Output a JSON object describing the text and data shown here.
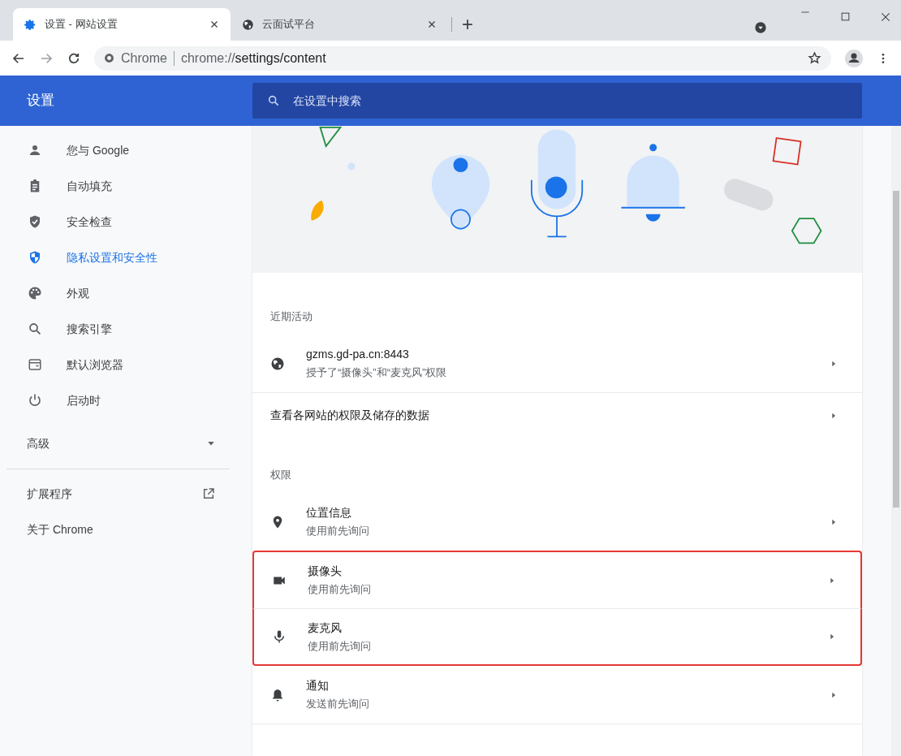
{
  "tabs": [
    {
      "title": "设置 - 网站设置",
      "selected": true,
      "kind": "settings"
    },
    {
      "title": "云面试平台",
      "selected": false,
      "kind": "web"
    }
  ],
  "new_tab": "+",
  "address_bar": {
    "chip": "Chrome",
    "url_host": "chrome://",
    "url_path": "settings/content"
  },
  "header": {
    "title": "设置",
    "search_placeholder": "在设置中搜索"
  },
  "sidebar": {
    "items": [
      {
        "label": "您与 Google",
        "selected": false
      },
      {
        "label": "自动填充",
        "selected": false
      },
      {
        "label": "安全检查",
        "selected": false
      },
      {
        "label": "隐私设置和安全性",
        "selected": true
      },
      {
        "label": "外观",
        "selected": false
      },
      {
        "label": "搜索引擎",
        "selected": false
      },
      {
        "label": "默认浏览器",
        "selected": false
      },
      {
        "label": "启动时",
        "selected": false
      }
    ],
    "advanced": {
      "label": "高级",
      "expanded": false
    },
    "footer_items": [
      {
        "label": "扩展程序",
        "kind": "external"
      },
      {
        "label": "关于 Chrome",
        "kind": "plain"
      }
    ]
  },
  "sections": [
    {
      "heading": "近期活动",
      "rows": [
        {
          "kind": "site",
          "title": "gzms.gd-pa.cn:8443",
          "subtitle": "授予了“摄像头”和“麦克风”权限",
          "highlighted": false
        },
        {
          "kind": "link",
          "title": "查看各网站的权限及储存的数据",
          "highlighted": false
        }
      ]
    },
    {
      "heading": "权限",
      "rows": [
        {
          "kind": "permission",
          "title": "位置信息",
          "subtitle": "使用前先询问",
          "highlighted": false
        },
        {
          "kind": "permission",
          "title": "摄像头",
          "subtitle": "使用前先询问",
          "highlighted": true
        },
        {
          "kind": "permission",
          "title": "麦克风",
          "subtitle": "使用前先询问",
          "highlighted": true
        },
        {
          "kind": "permission",
          "title": "通知",
          "subtitle": "发送前先询问",
          "highlighted": false
        }
      ]
    }
  ]
}
